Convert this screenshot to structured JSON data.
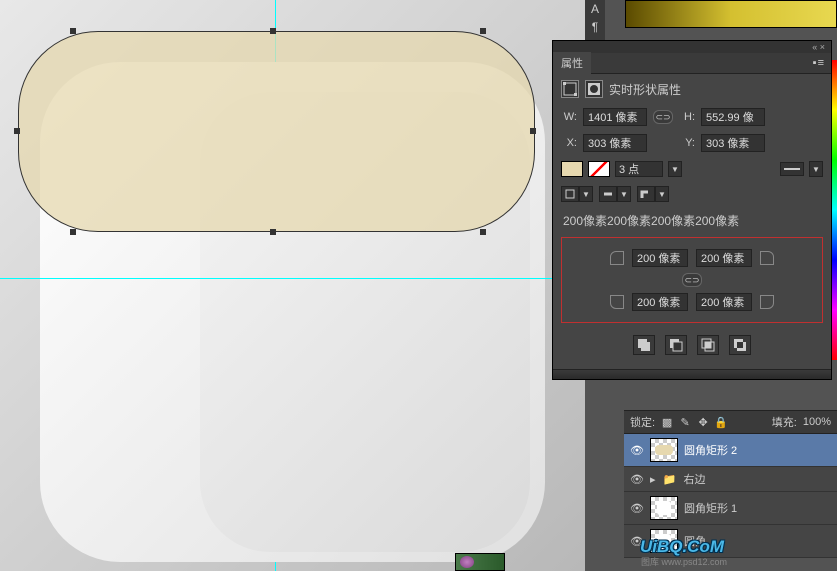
{
  "panel": {
    "title_tab": "属性",
    "subtitle": "实时形状属性",
    "w_label": "W:",
    "h_label": "H:",
    "x_label": "X:",
    "y_label": "Y:",
    "w_value": "1401 像素",
    "h_value": "552.99 像",
    "x_value": "303 像素",
    "y_value": "303 像素",
    "stroke_width": "3 点",
    "radius_summary": "200像素200像素200像素200像素",
    "corners": {
      "tl": "200 像素",
      "tr": "200 像素",
      "bl": "200 像素",
      "br": "200 像素"
    }
  },
  "layers": {
    "lock_label": "锁定:",
    "fill_label": "填充:",
    "fill_value": "100%",
    "items": [
      {
        "name": "圆角矩形 2"
      },
      {
        "name": "右边"
      },
      {
        "name": "圆角矩形 1"
      },
      {
        "name": "圆角"
      }
    ]
  },
  "watermark": {
    "main": "UiBQ.CoM",
    "sub": "图库 www.psd12.com"
  },
  "toolstrip": {
    "a": "A",
    "b": "¶"
  },
  "flyout": "« ×"
}
